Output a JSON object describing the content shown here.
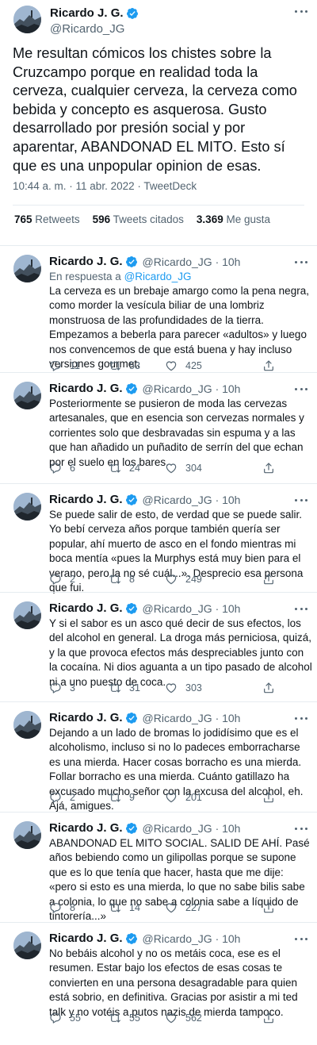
{
  "author": {
    "name": "Ricardo J. G.",
    "handle": "@Ricardo_JG",
    "avatar_icon": "avatar-mountain-photo",
    "verified_icon": "verified-badge-icon",
    "verified_color": "#1d9bf0"
  },
  "main_tweet": {
    "text": "Me resultan cómicos los chistes sobre la Cruzcampo porque en realidad toda la cerveza, cualquier cerveza, la cerveza como bebida y concepto es asquerosa. Gusto desarrollado por presión social y por aparentar, ABANDONAD EL MITO.  Esto sí que es una unpopular opinion de esas.",
    "timestamp": "10:44 a. m. · 11 abr. 2022 · TweetDeck",
    "stats": {
      "retweets_count": "765",
      "retweets_label": "Retweets",
      "quotes_count": "596",
      "quotes_label": "Tweets citados",
      "likes_count": "3.369",
      "likes_label": "Me gusta"
    }
  },
  "replies": [
    {
      "time": "· 10h",
      "reply_to_label": "En respuesta a",
      "reply_to_handle": "@Ricardo_JG",
      "text": "La cerveza es un brebaje amargo como la pena negra, como morder la vesícula biliar de una lombriz monstruosa de las profundidades de la tierra. Empezamos a beberla para parecer «adultos» y luego nos convencemos de que está buena y hay incluso versiones gourmet.",
      "replies": "11",
      "retweets": "53",
      "likes": "425"
    },
    {
      "time": "· 10h",
      "text": "Posteriormente se pusieron de moda las cervezas artesanales, que en esencia son cervezas normales y corrientes solo que desbravadas sin espuma y a las que han añadido un puñadito de serrín del que echan por el suelo en los bares.",
      "replies": "6",
      "retweets": "24",
      "likes": "304"
    },
    {
      "time": "· 10h",
      "text": "Se puede salir de esto, de verdad que se puede salir. Yo bebí cerveza años porque también quería ser popular, ahí muerto de asco en el fondo mientras mi boca mentía «pues la Murphys está muy bien para el verano, pero la no sé cuál...». Desprecio esa persona que fui.",
      "replies": "2",
      "retweets": "8",
      "likes": "249"
    },
    {
      "time": "· 10h",
      "text": "Y si el sabor es un asco qué decir de sus efectos, los del alcohol en general. La droga más perniciosa, quizá, y la que provoca efectos más despreciables junto con la cocaína. Ni dios aguanta a un tipo pasado de alcohol ni a uno puesto de coca.",
      "replies": "3",
      "retweets": "31",
      "likes": "303"
    },
    {
      "time": "· 10h",
      "text": "Dejando a un lado de bromas lo jodidísimo que es el alcoholismo, incluso si no lo padeces emborracharse es una mierda. Hacer cosas borracho es una mierda. Follar borracho es una mierda. Cuánto gatillazo ha excusado mucho señor con la excusa del alcohol, eh. Ajá, amigues.",
      "replies": "2",
      "retweets": "9",
      "likes": "201"
    },
    {
      "time": "· 10h",
      "text": "ABANDONAD EL MITO SOCIAL. SALID DE AHÍ. Pasé años bebiendo como un gilipollas porque se supone que es lo que tenía que hacer, hasta que me dije: «pero si esto es una mierda, lo que no sabe bilis sabe a colonia, lo que no sabe a colonia sabe a líquido de tintorería...»",
      "replies": "8",
      "retweets": "14",
      "likes": "227"
    },
    {
      "time": "· 10h",
      "text": "No bebáis alcohol y no os metáis coca, ese es el resumen. Estar bajo los efectos de esas cosas te convierten en una persona desagradable para quien está sobrio, en definitiva. Gracias por asistir a mi ted talk y no votéis a putos nazis de mierda tampoco.",
      "replies": "55",
      "retweets": "55",
      "likes": "562"
    }
  ],
  "icons": {
    "more": "more-dots-icon",
    "reply": "reply-bubble-icon",
    "retweet": "retweet-arrows-icon",
    "like": "heart-icon",
    "share": "share-upload-icon"
  },
  "colors": {
    "text": "#0f1419",
    "muted": "#536471",
    "link": "#1d9bf0",
    "divider": "#e6ecf0"
  }
}
